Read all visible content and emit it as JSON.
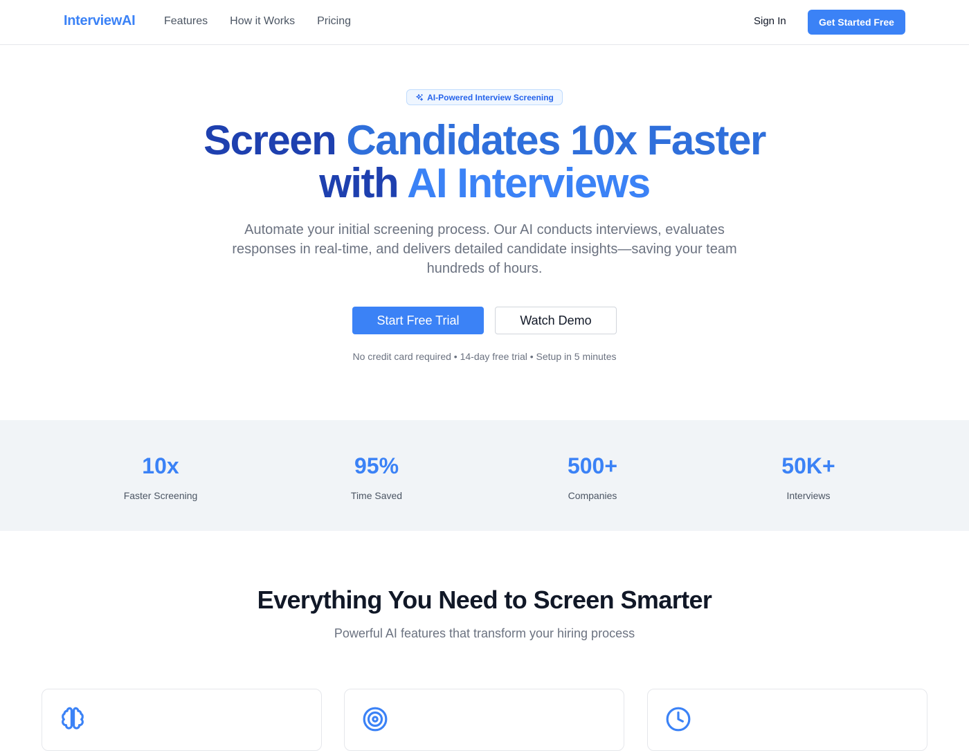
{
  "nav": {
    "brand": "InterviewAI",
    "links": [
      "Features",
      "How it Works",
      "Pricing"
    ],
    "sign_in": "Sign In",
    "cta": "Get Started Free"
  },
  "hero": {
    "badge": "AI-Powered Interview Screening",
    "title_line1_a": "Screen ",
    "title_line1_b": "Candidates 10x Faster",
    "title_line2_a": "with ",
    "title_line2_b": "AI Interviews",
    "subtitle": "Automate your initial screening process. Our AI conducts interviews, evaluates responses in real-time, and delivers detailed candidate insights—saving your team hundreds of hours.",
    "primary_cta": "Start Free Trial",
    "secondary_cta": "Watch Demo",
    "fineprint": "No credit card required • 14-day free trial • Setup in 5 minutes"
  },
  "stats": [
    {
      "value": "10x",
      "label": "Faster Screening"
    },
    {
      "value": "95%",
      "label": "Time Saved"
    },
    {
      "value": "500+",
      "label": "Companies"
    },
    {
      "value": "50K+",
      "label": "Interviews"
    }
  ],
  "features": {
    "title": "Everything You Need to Screen Smarter",
    "subtitle": "Powerful AI features that transform your hiring process",
    "card_icons": [
      "brain-icon",
      "target-icon",
      "clock-icon"
    ]
  },
  "colors": {
    "accent": "#3b82f6",
    "accent_dark": "#1e40af",
    "stats_bg": "#f1f4f7"
  }
}
